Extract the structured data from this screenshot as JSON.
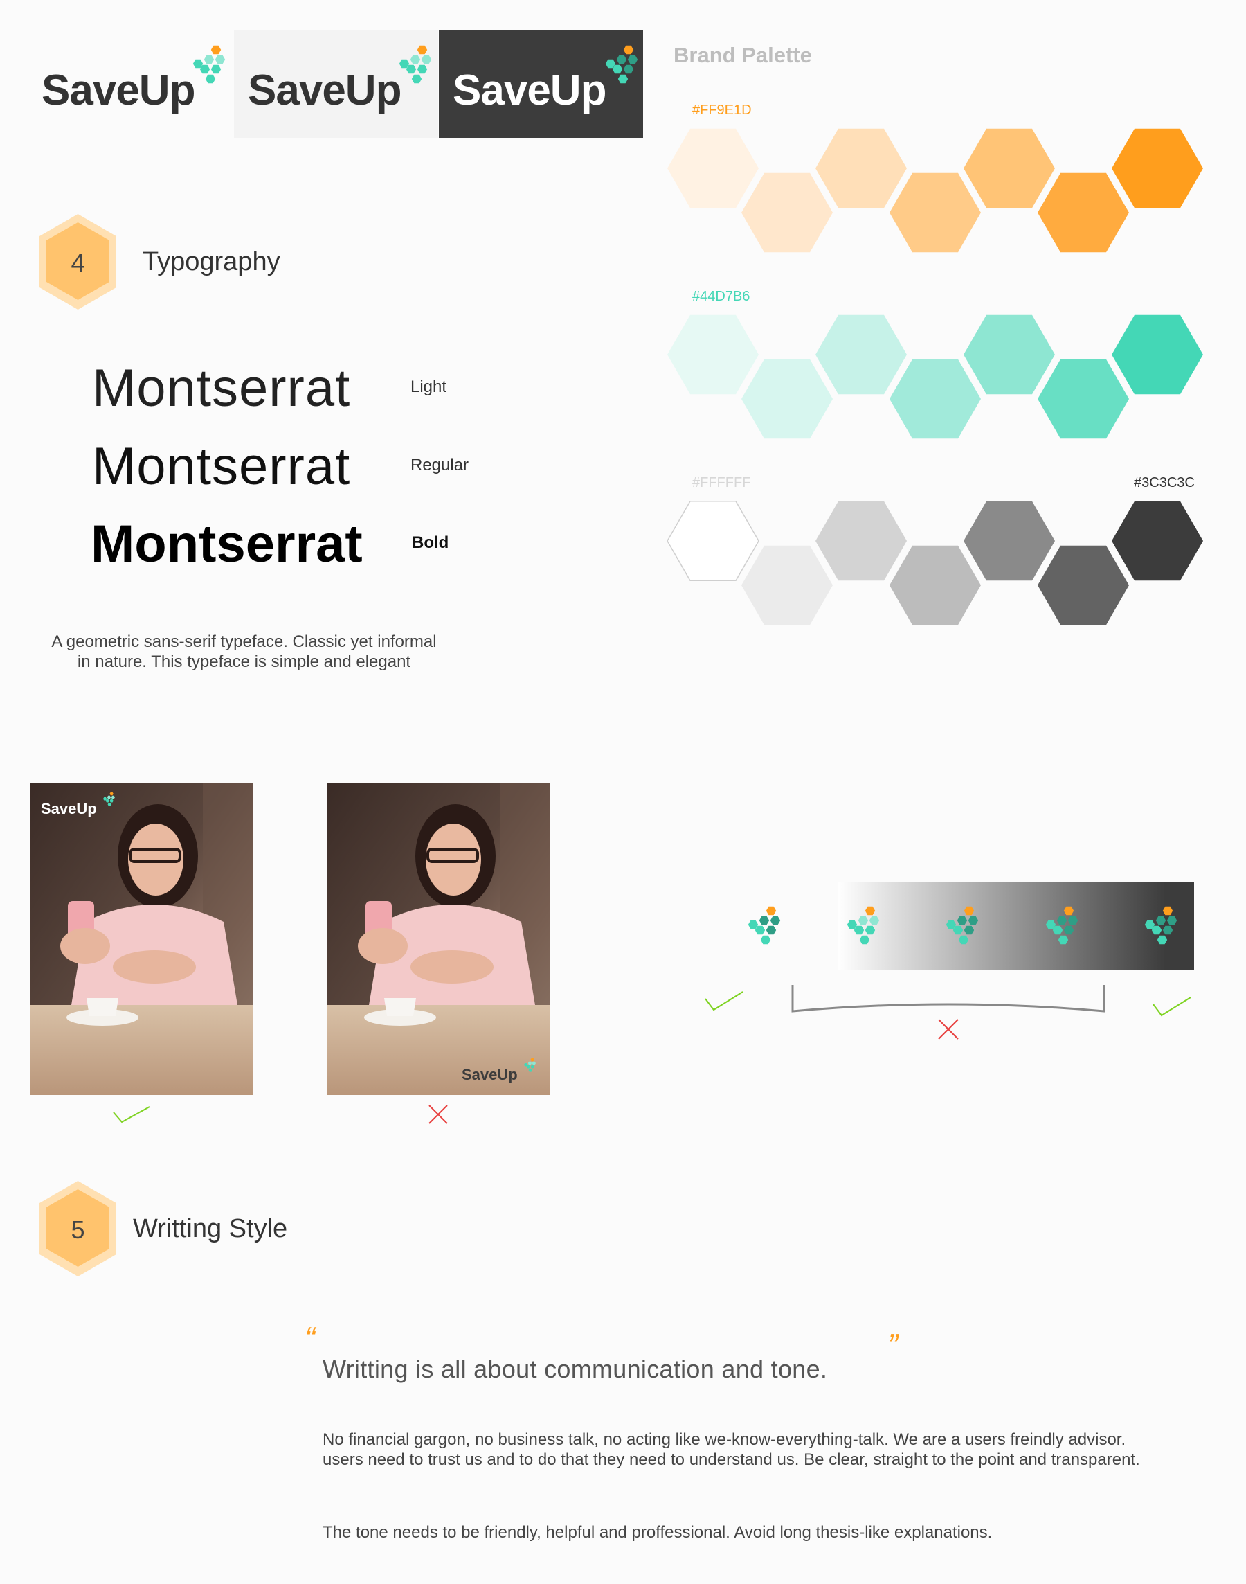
{
  "brand": {
    "name": "SaveUp",
    "logo_variants": [
      {
        "background": "none",
        "text_color": "#333333"
      },
      {
        "background": "#f3f3f3",
        "text_color": "#333333"
      },
      {
        "background": "#3c3c3c",
        "text_color": "#ffffff"
      }
    ]
  },
  "palette": {
    "title": "Brand Palette",
    "rows": [
      {
        "label_left": "#FF9E1D",
        "label_right": "",
        "label_color": "#FF9E1D",
        "swatches": [
          "#fff2e3",
          "#ffe7cc",
          "#ffdfb8",
          "#ffcb88",
          "#ffc476",
          "#ffab3f",
          "#ff9e1d"
        ]
      },
      {
        "label_left": "#44D7B6",
        "label_right": "",
        "label_color": "#44D7B6",
        "swatches": [
          "#e6f9f4",
          "#d7f6ef",
          "#c6f2e8",
          "#a1eada",
          "#8ee6d2",
          "#68dfc4",
          "#44d7b6"
        ]
      },
      {
        "label_left": "#FFFFFF",
        "label_right": "#3C3C3C",
        "label_color": "#d7d7d7",
        "swatches": [
          "#ffffff",
          "#ebebeb",
          "#d3d3d3",
          "#bcbcbc",
          "#8a8a8a",
          "#636363",
          "#3c3c3c"
        ]
      }
    ]
  },
  "typography": {
    "number": "4",
    "title": "Typography",
    "samples": [
      {
        "text": "Montserrat",
        "weight_label": "Light"
      },
      {
        "text": "Montserrat",
        "weight_label": "Regular"
      },
      {
        "text": "Montserrat",
        "weight_label": "Bold"
      }
    ],
    "description": "A geometric sans-serif typeface. Classic yet informal in nature. This typeface is simple and elegant"
  },
  "logo_usage": {
    "photo_examples": [
      {
        "logo_text": "SaveUp",
        "logo_position": "top-left",
        "verdict": "correct"
      },
      {
        "logo_text": "SaveUp",
        "logo_position": "bottom-right",
        "verdict": "incorrect"
      }
    ],
    "background_test": {
      "left_verdict": "correct",
      "middle_verdict": "incorrect",
      "right_verdict": "correct",
      "gradient": [
        "#ffffff",
        "#3c3c3c"
      ]
    }
  },
  "writing": {
    "number": "5",
    "title": "Writting Style",
    "open_quote": "“",
    "close_quote": "”",
    "quote": "Writting is all about communication and tone.",
    "paragraph1": "No financial gargon, no business talk, no acting like we-know-everything-talk. We are a users freindly advisor. users need to trust us and to do that they need to understand us. Be clear, straight to the point and transparent.",
    "paragraph2": "The tone needs to be friendly, helpful and proffessional. Avoid long thesis-like explanations."
  },
  "colors": {
    "orange": "#FF9E1D",
    "teal": "#44D7B6",
    "dark": "#3C3C3C",
    "check_green": "#7ed321",
    "cross_red": "#e8403f",
    "badge_orange": "#ffc36d",
    "badge_orange_light": "#ffe0b2"
  },
  "icons": {
    "check": "check-icon",
    "cross": "cross-icon",
    "logo_mark": "hexagon-cluster-icon",
    "quote": "quote-icon"
  }
}
